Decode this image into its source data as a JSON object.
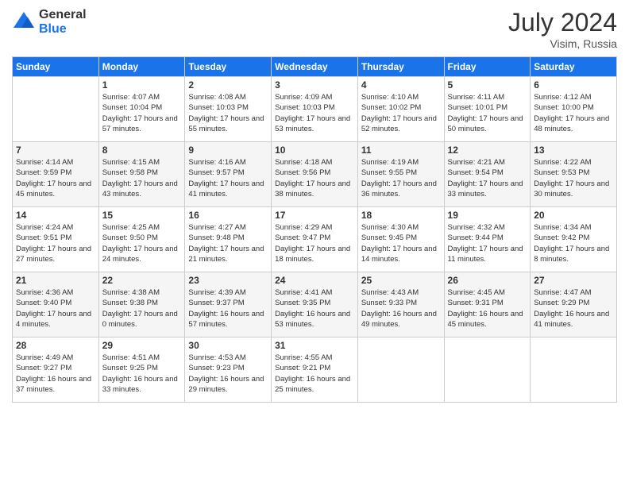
{
  "header": {
    "logo_general": "General",
    "logo_blue": "Blue",
    "title": "July 2024",
    "location": "Visim, Russia"
  },
  "days_of_week": [
    "Sunday",
    "Monday",
    "Tuesday",
    "Wednesday",
    "Thursday",
    "Friday",
    "Saturday"
  ],
  "weeks": [
    [
      {
        "day": "",
        "sunrise": "",
        "sunset": "",
        "daylight": ""
      },
      {
        "day": "1",
        "sunrise": "Sunrise: 4:07 AM",
        "sunset": "Sunset: 10:04 PM",
        "daylight": "Daylight: 17 hours and 57 minutes."
      },
      {
        "day": "2",
        "sunrise": "Sunrise: 4:08 AM",
        "sunset": "Sunset: 10:03 PM",
        "daylight": "Daylight: 17 hours and 55 minutes."
      },
      {
        "day": "3",
        "sunrise": "Sunrise: 4:09 AM",
        "sunset": "Sunset: 10:03 PM",
        "daylight": "Daylight: 17 hours and 53 minutes."
      },
      {
        "day": "4",
        "sunrise": "Sunrise: 4:10 AM",
        "sunset": "Sunset: 10:02 PM",
        "daylight": "Daylight: 17 hours and 52 minutes."
      },
      {
        "day": "5",
        "sunrise": "Sunrise: 4:11 AM",
        "sunset": "Sunset: 10:01 PM",
        "daylight": "Daylight: 17 hours and 50 minutes."
      },
      {
        "day": "6",
        "sunrise": "Sunrise: 4:12 AM",
        "sunset": "Sunset: 10:00 PM",
        "daylight": "Daylight: 17 hours and 48 minutes."
      }
    ],
    [
      {
        "day": "7",
        "sunrise": "Sunrise: 4:14 AM",
        "sunset": "Sunset: 9:59 PM",
        "daylight": "Daylight: 17 hours and 45 minutes."
      },
      {
        "day": "8",
        "sunrise": "Sunrise: 4:15 AM",
        "sunset": "Sunset: 9:58 PM",
        "daylight": "Daylight: 17 hours and 43 minutes."
      },
      {
        "day": "9",
        "sunrise": "Sunrise: 4:16 AM",
        "sunset": "Sunset: 9:57 PM",
        "daylight": "Daylight: 17 hours and 41 minutes."
      },
      {
        "day": "10",
        "sunrise": "Sunrise: 4:18 AM",
        "sunset": "Sunset: 9:56 PM",
        "daylight": "Daylight: 17 hours and 38 minutes."
      },
      {
        "day": "11",
        "sunrise": "Sunrise: 4:19 AM",
        "sunset": "Sunset: 9:55 PM",
        "daylight": "Daylight: 17 hours and 36 minutes."
      },
      {
        "day": "12",
        "sunrise": "Sunrise: 4:21 AM",
        "sunset": "Sunset: 9:54 PM",
        "daylight": "Daylight: 17 hours and 33 minutes."
      },
      {
        "day": "13",
        "sunrise": "Sunrise: 4:22 AM",
        "sunset": "Sunset: 9:53 PM",
        "daylight": "Daylight: 17 hours and 30 minutes."
      }
    ],
    [
      {
        "day": "14",
        "sunrise": "Sunrise: 4:24 AM",
        "sunset": "Sunset: 9:51 PM",
        "daylight": "Daylight: 17 hours and 27 minutes."
      },
      {
        "day": "15",
        "sunrise": "Sunrise: 4:25 AM",
        "sunset": "Sunset: 9:50 PM",
        "daylight": "Daylight: 17 hours and 24 minutes."
      },
      {
        "day": "16",
        "sunrise": "Sunrise: 4:27 AM",
        "sunset": "Sunset: 9:48 PM",
        "daylight": "Daylight: 17 hours and 21 minutes."
      },
      {
        "day": "17",
        "sunrise": "Sunrise: 4:29 AM",
        "sunset": "Sunset: 9:47 PM",
        "daylight": "Daylight: 17 hours and 18 minutes."
      },
      {
        "day": "18",
        "sunrise": "Sunrise: 4:30 AM",
        "sunset": "Sunset: 9:45 PM",
        "daylight": "Daylight: 17 hours and 14 minutes."
      },
      {
        "day": "19",
        "sunrise": "Sunrise: 4:32 AM",
        "sunset": "Sunset: 9:44 PM",
        "daylight": "Daylight: 17 hours and 11 minutes."
      },
      {
        "day": "20",
        "sunrise": "Sunrise: 4:34 AM",
        "sunset": "Sunset: 9:42 PM",
        "daylight": "Daylight: 17 hours and 8 minutes."
      }
    ],
    [
      {
        "day": "21",
        "sunrise": "Sunrise: 4:36 AM",
        "sunset": "Sunset: 9:40 PM",
        "daylight": "Daylight: 17 hours and 4 minutes."
      },
      {
        "day": "22",
        "sunrise": "Sunrise: 4:38 AM",
        "sunset": "Sunset: 9:38 PM",
        "daylight": "Daylight: 17 hours and 0 minutes."
      },
      {
        "day": "23",
        "sunrise": "Sunrise: 4:39 AM",
        "sunset": "Sunset: 9:37 PM",
        "daylight": "Daylight: 16 hours and 57 minutes."
      },
      {
        "day": "24",
        "sunrise": "Sunrise: 4:41 AM",
        "sunset": "Sunset: 9:35 PM",
        "daylight": "Daylight: 16 hours and 53 minutes."
      },
      {
        "day": "25",
        "sunrise": "Sunrise: 4:43 AM",
        "sunset": "Sunset: 9:33 PM",
        "daylight": "Daylight: 16 hours and 49 minutes."
      },
      {
        "day": "26",
        "sunrise": "Sunrise: 4:45 AM",
        "sunset": "Sunset: 9:31 PM",
        "daylight": "Daylight: 16 hours and 45 minutes."
      },
      {
        "day": "27",
        "sunrise": "Sunrise: 4:47 AM",
        "sunset": "Sunset: 9:29 PM",
        "daylight": "Daylight: 16 hours and 41 minutes."
      }
    ],
    [
      {
        "day": "28",
        "sunrise": "Sunrise: 4:49 AM",
        "sunset": "Sunset: 9:27 PM",
        "daylight": "Daylight: 16 hours and 37 minutes."
      },
      {
        "day": "29",
        "sunrise": "Sunrise: 4:51 AM",
        "sunset": "Sunset: 9:25 PM",
        "daylight": "Daylight: 16 hours and 33 minutes."
      },
      {
        "day": "30",
        "sunrise": "Sunrise: 4:53 AM",
        "sunset": "Sunset: 9:23 PM",
        "daylight": "Daylight: 16 hours and 29 minutes."
      },
      {
        "day": "31",
        "sunrise": "Sunrise: 4:55 AM",
        "sunset": "Sunset: 9:21 PM",
        "daylight": "Daylight: 16 hours and 25 minutes."
      },
      {
        "day": "",
        "sunrise": "",
        "sunset": "",
        "daylight": ""
      },
      {
        "day": "",
        "sunrise": "",
        "sunset": "",
        "daylight": ""
      },
      {
        "day": "",
        "sunrise": "",
        "sunset": "",
        "daylight": ""
      }
    ]
  ]
}
